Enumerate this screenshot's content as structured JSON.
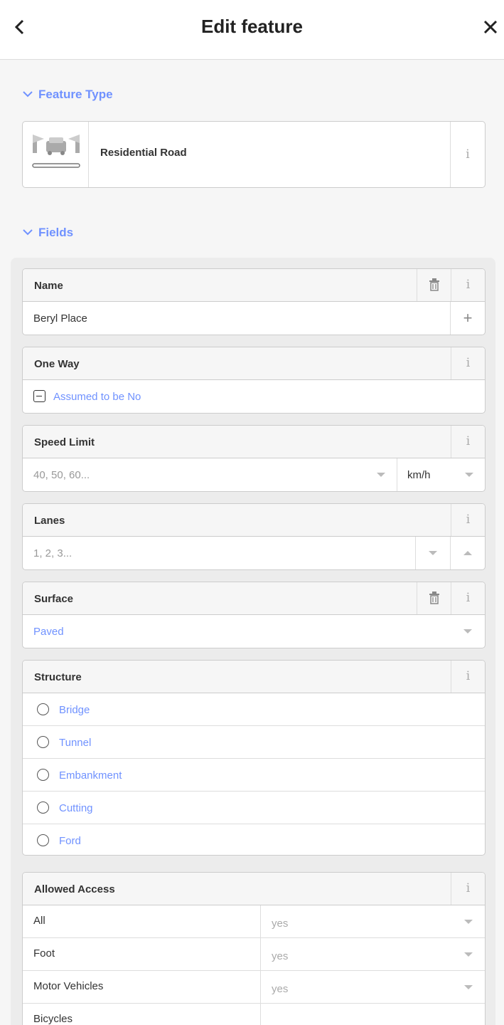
{
  "header": {
    "back_icon": "chevron-left-icon",
    "title": "Edit feature",
    "close_icon": "close-icon"
  },
  "feature_type": {
    "heading": "Feature Type",
    "preset_label": "Residential Road",
    "preset_icon": "residential-road-icon",
    "info_label": "i"
  },
  "fields_heading": "Fields",
  "accent_color": "#7092ff",
  "fields": {
    "name": {
      "label": "Name",
      "value": "Beryl Place",
      "add_label": "+"
    },
    "oneway": {
      "label": "One Way",
      "value": "Assumed to be No"
    },
    "speed_limit": {
      "label": "Speed Limit",
      "placeholder": "40, 50, 60...",
      "unit": "km/h"
    },
    "lanes": {
      "label": "Lanes",
      "placeholder": "1, 2, 3..."
    },
    "surface": {
      "label": "Surface",
      "value": "Paved"
    },
    "structure": {
      "label": "Structure",
      "options": [
        "Bridge",
        "Tunnel",
        "Embankment",
        "Cutting",
        "Ford"
      ]
    },
    "access": {
      "label": "Allowed Access",
      "rows": [
        {
          "key": "All",
          "value": "yes"
        },
        {
          "key": "Foot",
          "value": "yes"
        },
        {
          "key": "Motor Vehicles",
          "value": "yes"
        },
        {
          "key": "Bicycles",
          "value": ""
        }
      ]
    }
  },
  "info_glyph": "i"
}
